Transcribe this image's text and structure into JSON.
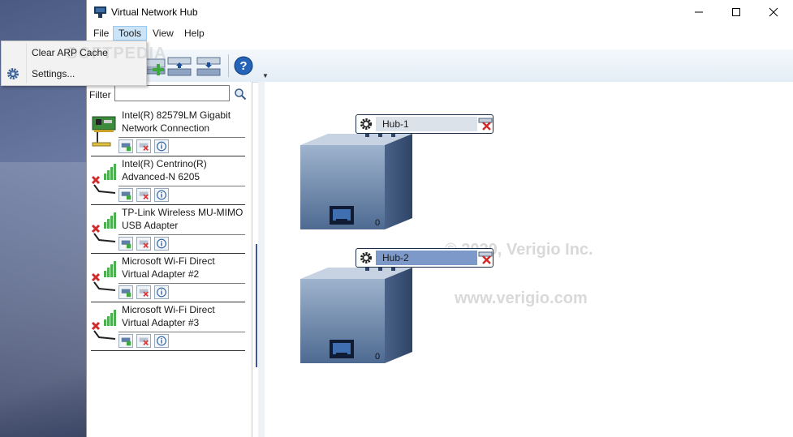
{
  "window": {
    "title": "Virtual Network Hub"
  },
  "menu": {
    "file": "File",
    "tools": "Tools",
    "view": "View",
    "help": "Help"
  },
  "tools_menu": {
    "items": [
      {
        "label": "Clear ARP Cache"
      },
      {
        "label": "Settings..."
      }
    ]
  },
  "filter": {
    "label": "Filter",
    "value": ""
  },
  "adapters": [
    {
      "name": "Intel(R) 82579LM Gigabit Network Connection",
      "state": "wired"
    },
    {
      "name": "Intel(R) Centrino(R) Advanced-N 6205",
      "state": "wireless-disconnected"
    },
    {
      "name": "TP-Link Wireless MU-MIMO USB Adapter",
      "state": "wireless-disconnected"
    },
    {
      "name": "Microsoft Wi-Fi Direct Virtual Adapter #2",
      "state": "wireless-disconnected"
    },
    {
      "name": "Microsoft Wi-Fi Direct Virtual Adapter #3",
      "state": "wireless-disconnected"
    }
  ],
  "hubs": [
    {
      "name": "Hub-1",
      "port_count": "0",
      "selected": false
    },
    {
      "name": "Hub-2",
      "port_count": "0",
      "selected": true
    }
  ],
  "watermark": {
    "copyright": "© 2020, Verigio Inc.",
    "url": "www.verigio.com",
    "softpedia": "SOFTPEDIA"
  },
  "colors": {
    "accent": "#3a57a8",
    "hub_box": "#5d7599",
    "selected_title": "#7c99c9"
  }
}
